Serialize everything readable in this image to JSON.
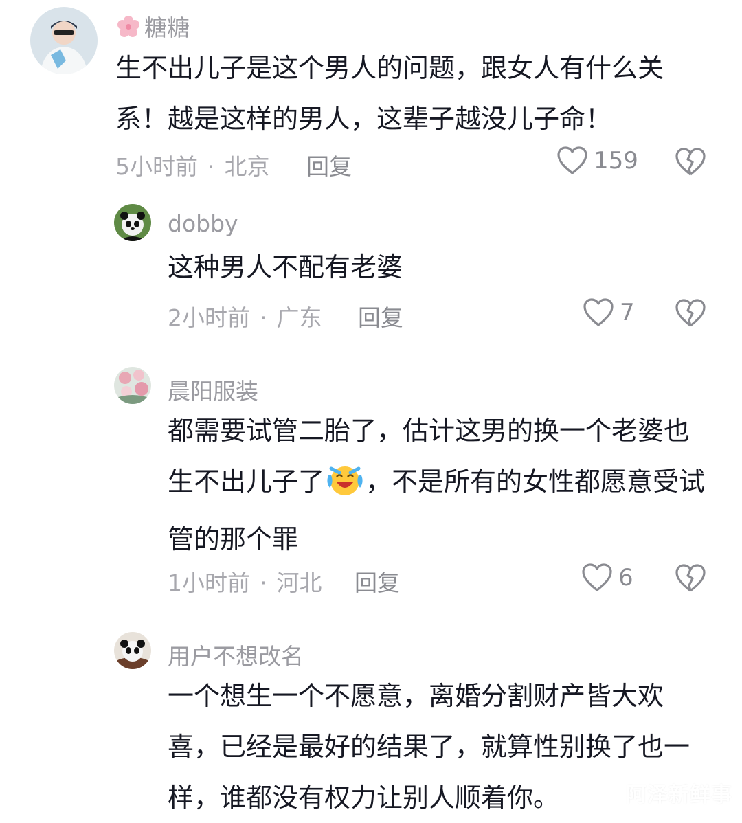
{
  "comments": [
    {
      "username": "糖糖",
      "text": "生不出儿子是这个男人的问题，跟女人有什么关系！越是这样的男人，这辈子越没儿子命！",
      "time": "5小时前",
      "location": "北京",
      "reply_label": "回复",
      "likes": "159",
      "avatar_icon": "user-photo-avatar"
    },
    {
      "username": "dobby",
      "text": "这种男人不配有老婆",
      "time": "2小时前",
      "location": "广东",
      "reply_label": "回复",
      "likes": "7",
      "avatar_icon": "panda-avatar"
    },
    {
      "username": "晨阳服装",
      "text_a": "都需要试管二胎了，估计这男的换一个老婆也生不出儿子了",
      "text_b": "，不是所有的女性都愿意受试管的那个罪",
      "time": "1小时前",
      "location": "河北",
      "reply_label": "回复",
      "likes": "6",
      "avatar_icon": "flower-photo-avatar",
      "emoji": "laughing-crying-emoji"
    },
    {
      "username": "用户不想改名",
      "text": "一个想生一个不愿意，离婚分割财产皆大欢喜，已经是最好的结果了，就算性别换了也一样，谁都没有权力让别人顺着你。",
      "avatar_icon": "panda-avatar-2"
    }
  ],
  "separator": "·",
  "watermark": "阿泽新鲜事",
  "colors": {
    "text": "#161823",
    "meta": "#a7a7ad",
    "username": "#9b9ba1",
    "icon": "#8a8b91"
  }
}
